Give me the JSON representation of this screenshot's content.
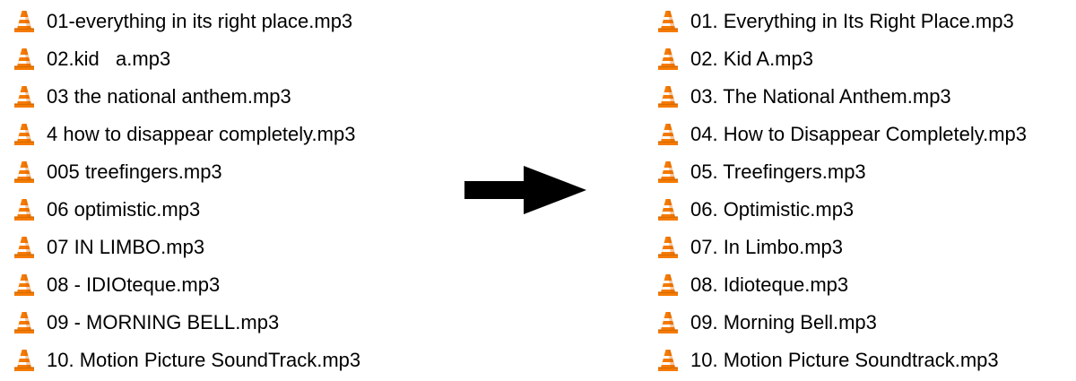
{
  "icons": {
    "file_icon": "vlc-cone-icon",
    "arrow_icon": "right-arrow-icon"
  },
  "colors": {
    "cone_orange": "#F57A00",
    "cone_stripe": "#FFFFFF",
    "arrow": "#000000",
    "background": "#FFFFFF"
  },
  "before": {
    "files": [
      {
        "name": "01-everything in its right place.mp3"
      },
      {
        "name": "02.kid   a.mp3"
      },
      {
        "name": "03 the national anthem.mp3"
      },
      {
        "name": "4 how to disappear completely.mp3"
      },
      {
        "name": "005 treefingers.mp3"
      },
      {
        "name": "06 optimistic.mp3"
      },
      {
        "name": "07 IN LIMBO.mp3"
      },
      {
        "name": "08 - IDIOteque.mp3"
      },
      {
        "name": "09 - MORNING BELL.mp3"
      },
      {
        "name": "10. Motion Picture SoundTrack.mp3"
      }
    ]
  },
  "after": {
    "files": [
      {
        "name": "01. Everything in Its Right Place.mp3"
      },
      {
        "name": "02. Kid A.mp3"
      },
      {
        "name": "03. The National Anthem.mp3"
      },
      {
        "name": "04. How to Disappear Completely.mp3"
      },
      {
        "name": "05. Treefingers.mp3"
      },
      {
        "name": "06. Optimistic.mp3"
      },
      {
        "name": "07. In Limbo.mp3"
      },
      {
        "name": "08. Idioteque.mp3"
      },
      {
        "name": "09. Morning Bell.mp3"
      },
      {
        "name": "10. Motion Picture Soundtrack.mp3"
      }
    ]
  }
}
